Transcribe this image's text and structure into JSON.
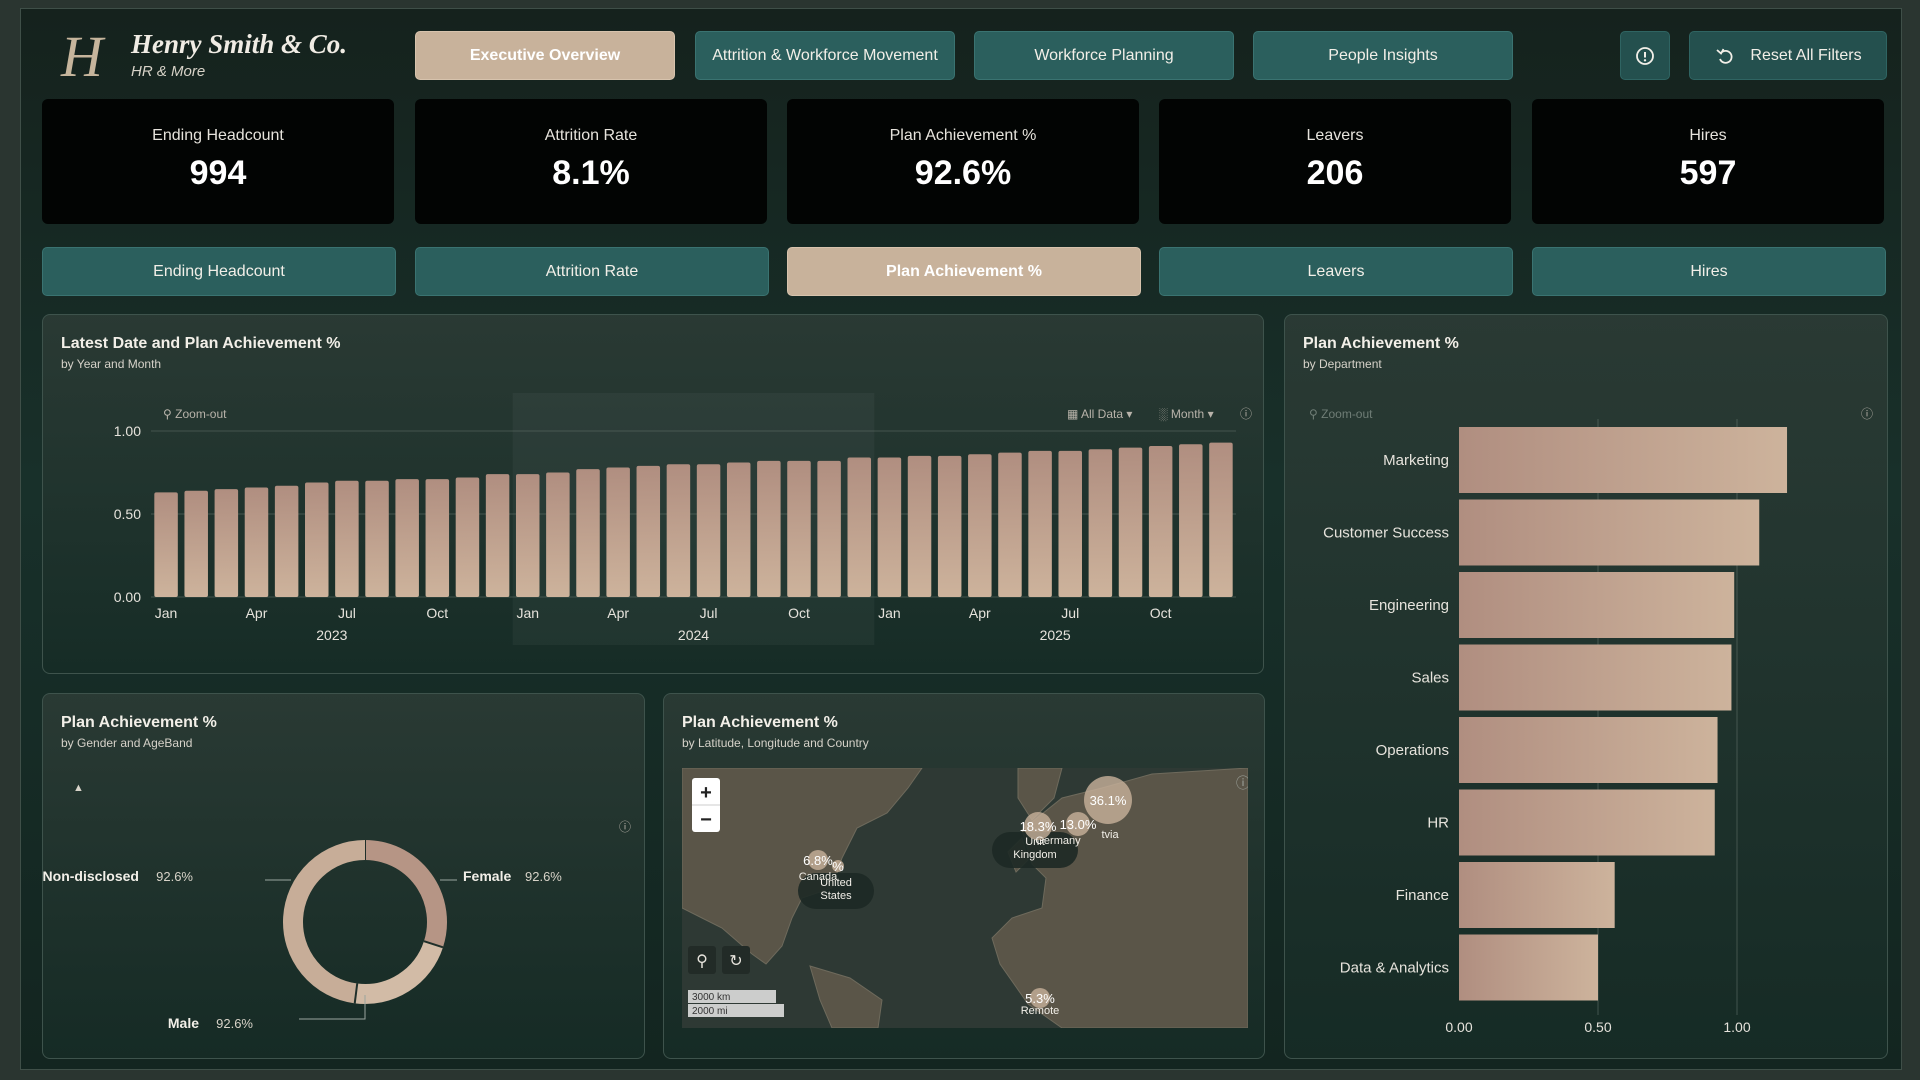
{
  "brand": {
    "logo_letter": "H",
    "title": "Henry Smith & Co.",
    "subtitle": "HR & More"
  },
  "nav": {
    "tabs": [
      {
        "label": "Executive Overview",
        "active": true
      },
      {
        "label": "Attrition & Workforce Movement",
        "active": false
      },
      {
        "label": "Workforce Planning",
        "active": false
      },
      {
        "label": "People Insights",
        "active": false
      }
    ],
    "info_icon": "info-icon",
    "reset_label": "Reset All Filters",
    "reset_icon": "undo-icon"
  },
  "kpis": [
    {
      "label": "Ending Headcount",
      "value": "994"
    },
    {
      "label": "Attrition Rate",
      "value": "8.1%"
    },
    {
      "label": "Plan Achievement %",
      "value": "92.6%"
    },
    {
      "label": "Leavers",
      "value": "206"
    },
    {
      "label": "Hires",
      "value": "597"
    }
  ],
  "metric_selector": [
    {
      "label": "Ending Headcount",
      "active": false
    },
    {
      "label": "Attrition Rate",
      "active": false
    },
    {
      "label": "Plan Achievement %",
      "active": true
    },
    {
      "label": "Leavers",
      "active": false
    },
    {
      "label": "Hires",
      "active": false
    }
  ],
  "colors": {
    "bar": "#b08e80",
    "bar_light": "#cdb39c",
    "accent": "#c8b29b",
    "button": "#2b5f5d"
  },
  "chart_data": [
    {
      "type": "bar",
      "title": "Latest Date and Plan Achievement %",
      "subtitle": "by Year and Month",
      "toolbar": {
        "zoom": "Zoom-out",
        "range": "All Data",
        "granularity": "Month"
      },
      "x_tick_labels": [
        "Jan",
        "Apr",
        "Jul",
        "Oct",
        "Jan",
        "Apr",
        "Jul",
        "Oct",
        "Jan",
        "Apr",
        "Jul",
        "Oct"
      ],
      "year_labels": [
        "2023",
        "2024",
        "2025"
      ],
      "categories": [
        "2023-01",
        "2023-02",
        "2023-03",
        "2023-04",
        "2023-05",
        "2023-06",
        "2023-07",
        "2023-08",
        "2023-09",
        "2023-10",
        "2023-11",
        "2023-12",
        "2024-01",
        "2024-02",
        "2024-03",
        "2024-04",
        "2024-05",
        "2024-06",
        "2024-07",
        "2024-08",
        "2024-09",
        "2024-10",
        "2024-11",
        "2024-12",
        "2025-01",
        "2025-02",
        "2025-03",
        "2025-04",
        "2025-05",
        "2025-06",
        "2025-07",
        "2025-08",
        "2025-09",
        "2025-10",
        "2025-11",
        "2025-12"
      ],
      "values": [
        0.63,
        0.64,
        0.65,
        0.66,
        0.67,
        0.69,
        0.7,
        0.7,
        0.71,
        0.71,
        0.72,
        0.74,
        0.74,
        0.75,
        0.77,
        0.78,
        0.79,
        0.8,
        0.8,
        0.81,
        0.82,
        0.82,
        0.82,
        0.84,
        0.84,
        0.85,
        0.85,
        0.86,
        0.87,
        0.88,
        0.88,
        0.89,
        0.9,
        0.91,
        0.92,
        0.93
      ],
      "y_ticks": [
        "0.00",
        "0.50",
        "1.00"
      ],
      "ylim": [
        0,
        1
      ],
      "grid": true
    },
    {
      "type": "bar",
      "orientation": "horizontal",
      "title": "Plan Achievement %",
      "subtitle": "by Department",
      "toolbar": {
        "zoom": "Zoom-out"
      },
      "categories": [
        "Marketing",
        "Customer Success",
        "Engineering",
        "Sales",
        "Operations",
        "HR",
        "Finance",
        "Data & Analytics"
      ],
      "values": [
        1.18,
        1.08,
        0.99,
        0.98,
        0.93,
        0.92,
        0.56,
        0.5
      ],
      "x_ticks": [
        "0.00",
        "0.50",
        "1.00"
      ],
      "xlim": [
        0,
        1.2
      ],
      "grid": true
    },
    {
      "type": "pie",
      "donut": true,
      "title": "Plan Achievement %",
      "subtitle": "by Gender and AgeBand",
      "slices": [
        {
          "name": "Female",
          "label": "92.6%",
          "value": 30
        },
        {
          "name": "Male",
          "label": "92.6%",
          "value": 22
        },
        {
          "name": "Non-disclosed",
          "label": "92.6%",
          "value": 48
        }
      ]
    },
    {
      "type": "map",
      "title": "Plan Achievement %",
      "subtitle": "by Latitude, Longitude and Country",
      "controls": {
        "zoom_in": "+",
        "zoom_out": "−"
      },
      "scale": [
        "3000 km",
        "2000 mi"
      ],
      "bubbles": [
        {
          "label": "36.1%",
          "country": "Latvia"
        },
        {
          "label": "18.3%",
          "country": "United Kingdom"
        },
        {
          "label": "13.0%",
          "country": "Germany"
        },
        {
          "label": "6.8%",
          "country": "Canada"
        },
        {
          "label": "%",
          "country": "United States"
        },
        {
          "label": "5.3%",
          "country": "Remote"
        }
      ],
      "country_labels": {
        "canada": "Canada",
        "us": "United\nStates",
        "uk": "Unit\nKingdom",
        "germany": "Germany",
        "latvia": "tvia",
        "remote": "Remote"
      }
    }
  ]
}
